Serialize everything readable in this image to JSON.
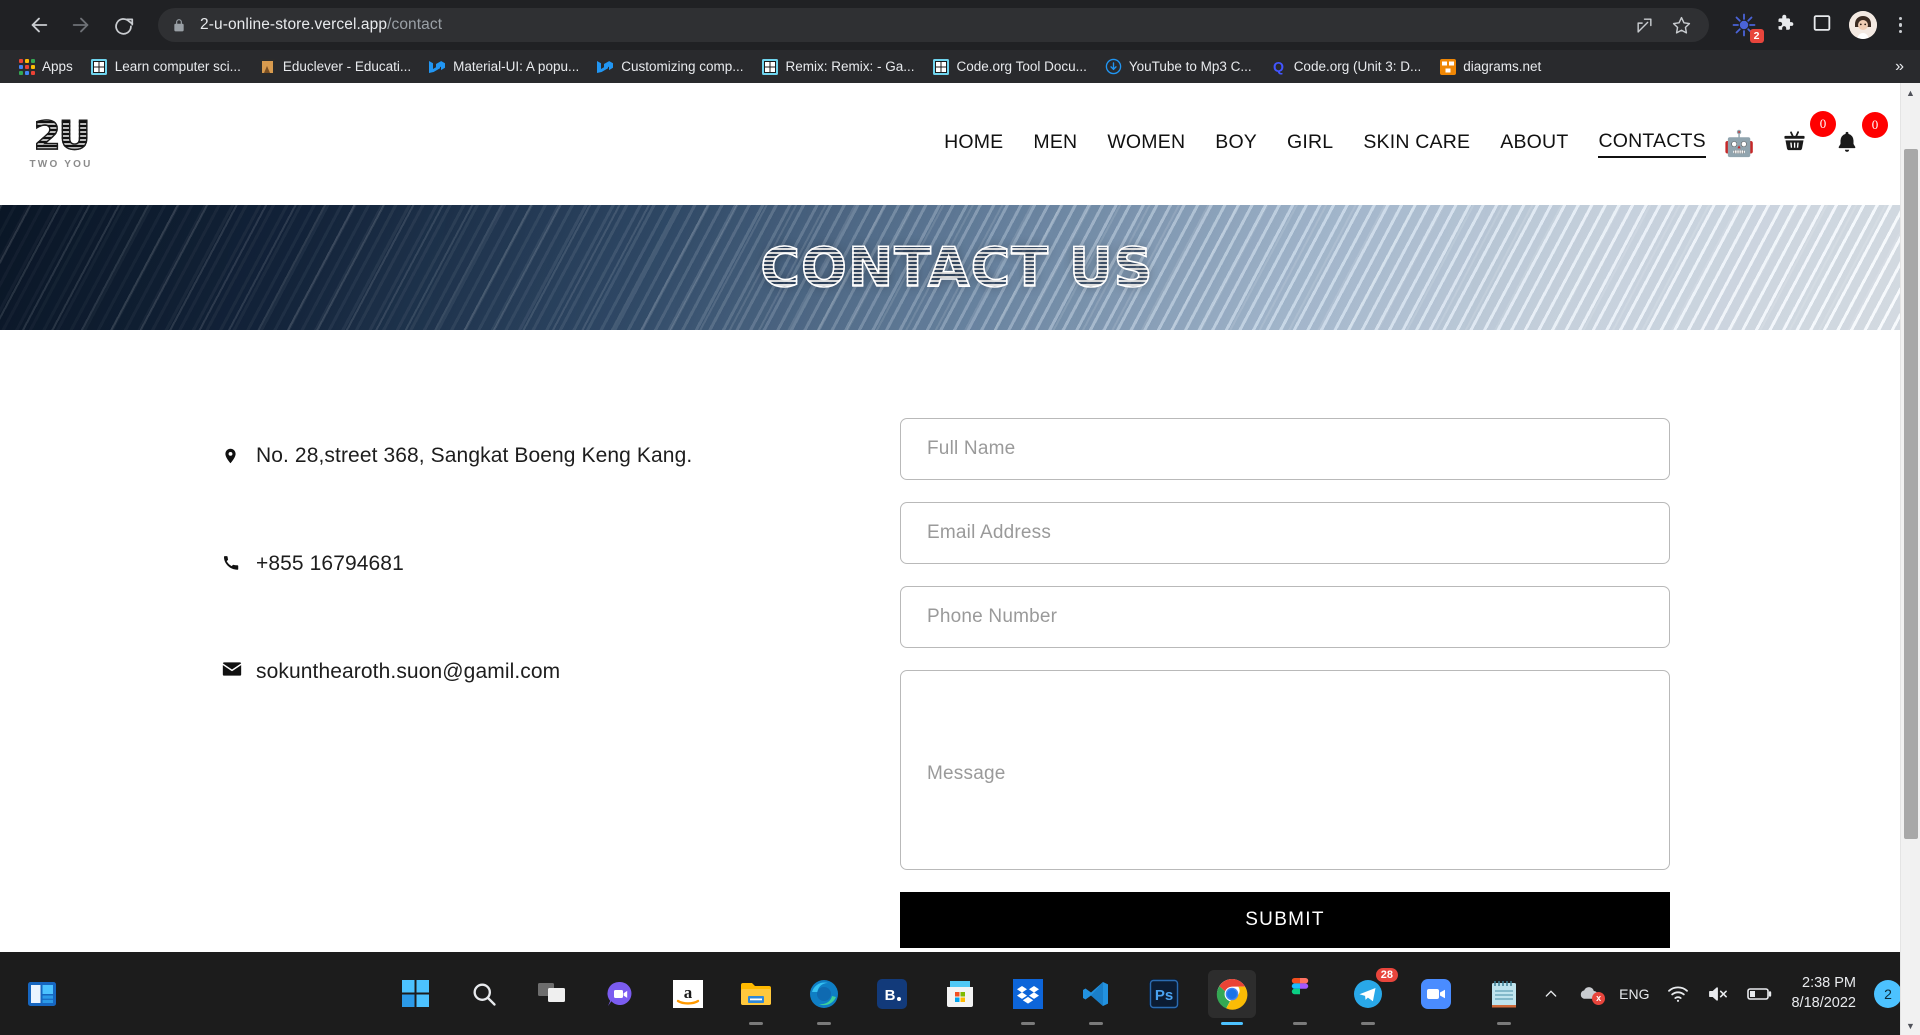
{
  "browser": {
    "url_domain": "2-u-online-store.vercel.app",
    "url_path": "/contact",
    "back_icon": "back-arrow-icon",
    "forward_icon": "forward-arrow-icon",
    "reload_icon": "reload-icon",
    "lock_icon": "lock-icon",
    "share_icon": "share-icon",
    "bookmark_icon": "star-icon",
    "extension_badge": "2",
    "bookmarks": [
      {
        "label": "Apps",
        "icon": "apps-grid-icon"
      },
      {
        "label": "Learn computer sci...",
        "icon": "grid-blue-icon"
      },
      {
        "label": "Educlever - Educati...",
        "icon": "educlever-icon"
      },
      {
        "label": "Material-UI: A popu...",
        "icon": "material-ui-icon"
      },
      {
        "label": "Customizing comp...",
        "icon": "material-ui-icon"
      },
      {
        "label": "Remix: Remix: - Ga...",
        "icon": "grid-blue-icon"
      },
      {
        "label": "Code.org Tool Docu...",
        "icon": "grid-blue-icon"
      },
      {
        "label": "YouTube to Mp3 C...",
        "icon": "download-cloud-icon"
      },
      {
        "label": "Code.org (Unit 3: D...",
        "icon": "quizlet-q-icon"
      },
      {
        "label": "diagrams.net",
        "icon": "diagrams-net-icon"
      }
    ],
    "overflow_label": "»"
  },
  "site": {
    "logo": {
      "mark": "2U",
      "sub": "TWO YOU"
    },
    "nav": [
      {
        "label": "HOME",
        "active": false
      },
      {
        "label": "MEN",
        "active": false
      },
      {
        "label": "WOMEN",
        "active": false
      },
      {
        "label": "BOY",
        "active": false
      },
      {
        "label": "GIRL",
        "active": false
      },
      {
        "label": "SKIN CARE",
        "active": false
      },
      {
        "label": "ABOUT",
        "active": false
      },
      {
        "label": "CONTACTS",
        "active": true
      }
    ],
    "header_icons": {
      "robot": "🤖",
      "cart_count": "0",
      "bell_count": "0"
    },
    "hero_title": "CONTACT US"
  },
  "contact_info": [
    {
      "icon": "location-pin-icon",
      "text": "No. 28,street 368, Sangkat Boeng Keng Kang."
    },
    {
      "icon": "phone-icon",
      "text": "+855 16794681"
    },
    {
      "icon": "envelope-icon",
      "text": "sokunthearoth.suon@gamil.com"
    }
  ],
  "form": {
    "full_name_placeholder": "Full Name",
    "full_name_value": "",
    "email_placeholder": "Email Address",
    "email_value": "",
    "phone_placeholder": "Phone Number",
    "phone_value": "",
    "message_placeholder": "Message",
    "message_value": "",
    "submit_label": "SUBMIT"
  },
  "taskbar": {
    "widgets_icon": "widgets-icon",
    "items": [
      {
        "name": "start",
        "label": "Start"
      },
      {
        "name": "search",
        "label": "Search"
      },
      {
        "name": "task-view",
        "label": "Task View"
      },
      {
        "name": "chat",
        "label": "Chat"
      },
      {
        "name": "amazon",
        "label": "Amazon"
      },
      {
        "name": "file-explorer",
        "label": "File Explorer"
      },
      {
        "name": "microsoft-edge",
        "label": "Microsoft Edge"
      },
      {
        "name": "booking",
        "label": "Booking"
      },
      {
        "name": "microsoft-store",
        "label": "Microsoft Store"
      },
      {
        "name": "dropbox",
        "label": "Dropbox"
      },
      {
        "name": "vs-code",
        "label": "Visual Studio Code"
      },
      {
        "name": "photoshop",
        "label": "Adobe Photoshop"
      },
      {
        "name": "google-chrome",
        "label": "Google Chrome"
      },
      {
        "name": "figma",
        "label": "Figma"
      },
      {
        "name": "telegram",
        "label": "Telegram",
        "badge": "28"
      },
      {
        "name": "zoom",
        "label": "Zoom"
      },
      {
        "name": "notepad",
        "label": "Notepad"
      }
    ],
    "tray": {
      "chevron": "^",
      "onedrive_error": "x",
      "language": "ENG",
      "wifi_icon": "wifi-icon",
      "volume_icon": "volume-muted-icon",
      "battery_icon": "battery-icon",
      "time": "2:38 PM",
      "date": "8/18/2022",
      "notification_count": "2"
    }
  },
  "colors": {
    "chrome_bg": "#202124",
    "bookmarks_bg": "#292a2d",
    "accent_red": "#ff0000",
    "taskbar_bg": "#1c1c1c",
    "submit_bg": "#000000",
    "hero_dark": "#0a1626"
  }
}
